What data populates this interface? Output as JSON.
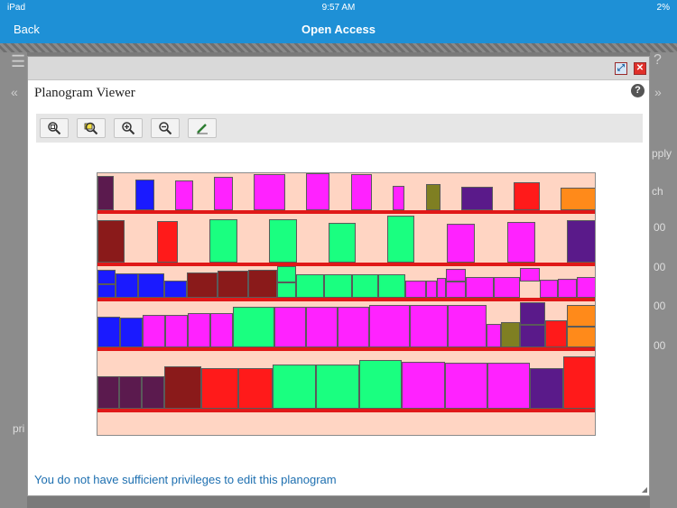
{
  "status_bar": {
    "carrier": "iPad",
    "wifi_icon": "wifi-icon",
    "time": "9:57 AM",
    "battery": "2%"
  },
  "nav": {
    "back_label": "Back",
    "title": "Open Access"
  },
  "background": {
    "menu_icon": "menu-icon",
    "help_icon": "help-icon",
    "partial_texts": [
      "pply",
      "ch",
      "00",
      "00",
      "00",
      "00",
      "pri"
    ]
  },
  "modal": {
    "title": "Planogram Viewer",
    "help_label": "?",
    "popout_icon": "popout-icon",
    "close_icon": "close-icon",
    "toolbar": [
      {
        "name": "zoom-fit-icon"
      },
      {
        "name": "zoom-area-icon"
      },
      {
        "name": "zoom-in-icon"
      },
      {
        "name": "zoom-out-icon"
      },
      {
        "name": "edit-pencil-icon"
      }
    ],
    "message": "You do not have sufficient privileges to edit this planogram"
  },
  "colors": {
    "accent": "#1e90d6",
    "link": "#1d6fb0",
    "shelf": "#e01818",
    "backdrop": "#ffd5c3"
  },
  "planogram": {
    "shelves": 5,
    "products_per_shelf": [
      11,
      9,
      17,
      15,
      14
    ]
  }
}
